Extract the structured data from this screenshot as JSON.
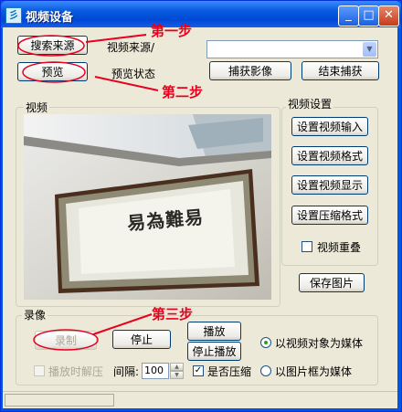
{
  "window": {
    "title": "视频设备"
  },
  "source": {
    "search_button": "搜索来源",
    "source_label": "视频来源/",
    "preview_button": "预览",
    "preview_status_label": "预览状态",
    "capture_button": "捕获影像",
    "end_capture_button": "结束捕获"
  },
  "video_group": {
    "title": "视频"
  },
  "settings_group": {
    "title": "视频设置",
    "input_button": "设置视频输入",
    "format_button": "设置视频格式",
    "display_button": "设置视频显示",
    "compression_button": "设置压缩格式",
    "overlay_label": "视频重叠"
  },
  "save_image_button": "保存图片",
  "record_group": {
    "title": "录像",
    "record_button": "录制",
    "stop_button": "停止",
    "play_button": "播放",
    "stop_play_button": "停止播放",
    "decompress_label": "播放时解压",
    "interval_label": "间隔:",
    "interval_value": "100",
    "compress_label": "是否压缩",
    "video_object_label": "以视频对象为媒体",
    "frame_label": "以图片框为媒体"
  },
  "annotations": {
    "step1": "第一步",
    "step2": "第二步",
    "step3": "第三步",
    "color": "#e8001d"
  },
  "calligraphy": {
    "text": "易為難易"
  }
}
